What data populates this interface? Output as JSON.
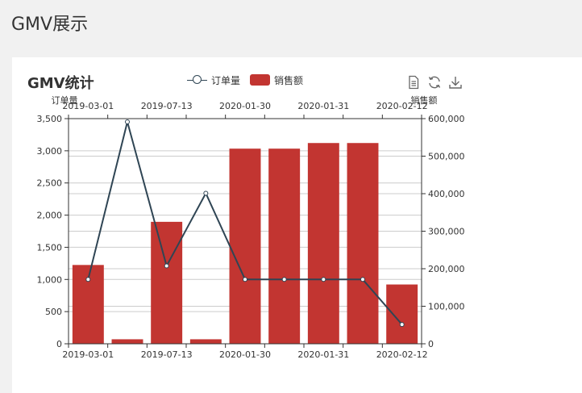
{
  "page": {
    "title": "GMV展示"
  },
  "card": {
    "title": "GMV统计"
  },
  "legend": {
    "orders": "订单量",
    "sales": "销售额"
  },
  "toolbox": [
    "data-view-icon",
    "refresh-icon",
    "download-icon"
  ],
  "colors": {
    "bar": "#c23531",
    "line": "#2f4554",
    "axis": "#333333",
    "grid": "#cccccc"
  },
  "chart_data": {
    "type": "bar",
    "title": "GMV统计",
    "categories": [
      "2019-03-01",
      "",
      "2019-07-13",
      "",
      "2020-01-30",
      "",
      "2020-01-31",
      "",
      "2020-02-12"
    ],
    "series": [
      {
        "name": "销售额",
        "type": "bar",
        "axis": "right",
        "values": [
          210000,
          12000,
          325000,
          12000,
          520000,
          520000,
          535000,
          535000,
          158000
        ]
      },
      {
        "name": "订单量",
        "type": "line",
        "axis": "left",
        "values": [
          1000,
          3450,
          1210,
          2340,
          1000,
          1000,
          1000,
          1000,
          300
        ]
      }
    ],
    "ylabel_left": "订单量",
    "ylabel_right": "销售额",
    "ylim_left": [
      0,
      3500
    ],
    "ylim_right": [
      0,
      600000
    ],
    "yticks_left": [
      "0",
      "500",
      "1,000",
      "1,500",
      "2,000",
      "2,500",
      "3,000",
      "3,500"
    ],
    "yticks_right": [
      "0",
      "100,000",
      "200,000",
      "300,000",
      "400,000",
      "500,000",
      "600,000"
    ],
    "grid": true,
    "legend_position": "top"
  }
}
